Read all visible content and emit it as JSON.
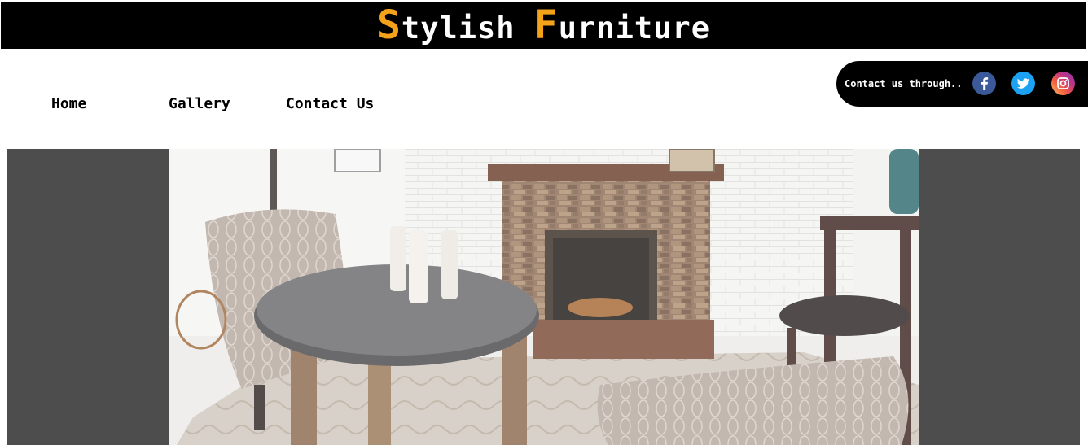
{
  "header": {
    "title_s": "S",
    "title_rest1": "tylish ",
    "title_f": "F",
    "title_rest2": "urniture",
    "accent_color": "#f5a21b"
  },
  "nav": {
    "items": [
      {
        "label": "Home"
      },
      {
        "label": "Gallery"
      },
      {
        "label": "Contact Us"
      }
    ]
  },
  "contact": {
    "text": "Contact us through..",
    "icons": [
      "facebook-icon",
      "twitter-icon",
      "instagram-icon"
    ]
  },
  "hero": {
    "image": "living-room-fireplace-photo",
    "background_color": "#4d4d4d"
  }
}
